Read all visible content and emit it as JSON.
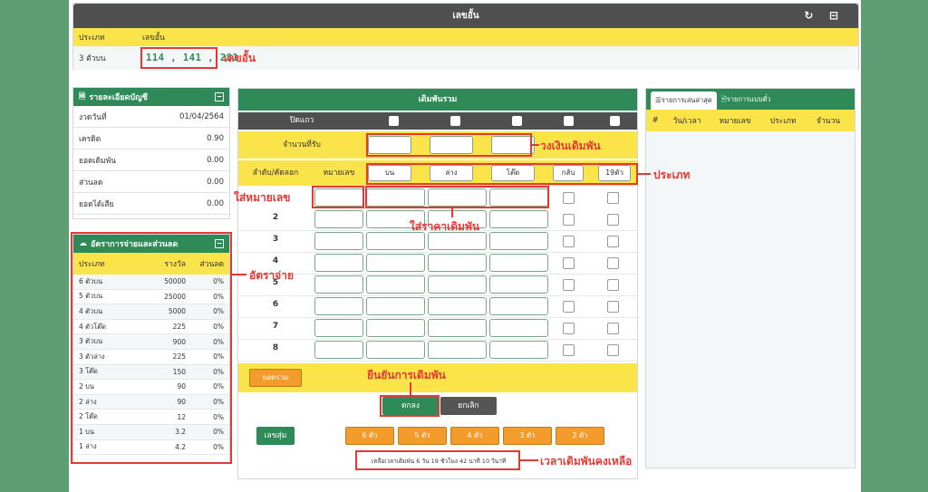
{
  "top": {
    "title": "เลขอั้น",
    "col_type": "ประเภท",
    "col_numbers": "เลขอั้น",
    "row_type": "3 ตัวบน",
    "row_numbers": "114 , 141 , 281"
  },
  "account": {
    "title": "รายละเอียดบัญชี",
    "rows": [
      {
        "label": "งวดวันที่",
        "value": "01/04/2564"
      },
      {
        "label": "เครดิต",
        "value": "0.90"
      },
      {
        "label": "ยอดเดิมพัน",
        "value": "0.00"
      },
      {
        "label": "ส่วนลด",
        "value": "0.00"
      },
      {
        "label": "ยอดได้เสีย",
        "value": "0.00"
      }
    ]
  },
  "rates": {
    "title": "อัตราการจ่ายและส่วนลด",
    "headers": [
      "ประเภท",
      "รางวัล",
      "ส่วนลด"
    ],
    "rows": [
      [
        "6 ตัวบน",
        "50000",
        "0%"
      ],
      [
        "5 ตัวบน",
        "25000",
        "0%"
      ],
      [
        "4 ตัวบน",
        "5000",
        "0%"
      ],
      [
        "4 ตัวโต๊ด",
        "225",
        "0%"
      ],
      [
        "3 ตัวบน",
        "900",
        "0%"
      ],
      [
        "3 ตัวล่าง",
        "225",
        "0%"
      ],
      [
        "3 โต๊ด",
        "150",
        "0%"
      ],
      [
        "2 บน",
        "90",
        "0%"
      ],
      [
        "2 ล่าง",
        "90",
        "0%"
      ],
      [
        "2 โต๊ด",
        "12",
        "0%"
      ],
      [
        "1 บน",
        "3.2",
        "0%"
      ],
      [
        "1 ล่าง",
        "4.2",
        "0%"
      ]
    ]
  },
  "bet": {
    "title": "เดิมพันรวม",
    "close_row": "ปิดแถว",
    "amount_label": "จำนวนที่รับ",
    "order_label": "ลำดับ/คัดลอก",
    "number_label": "หมายเลข",
    "types": [
      "บน",
      "ล่าง",
      "โต๊ด",
      "กลับ",
      "19ตัว"
    ],
    "row_numbers": [
      "2",
      "3",
      "4",
      "5",
      "6",
      "7",
      "8"
    ],
    "sum_button": "ยอดรวม",
    "ok_button": "ตกลง",
    "cancel_button": "ยกเลิก",
    "random_button": "เลขสุ่ม",
    "quick_buttons": [
      "6 ตัว",
      "5 ตัว",
      "4 ตัว",
      "3 ตัว",
      "2 ตัว"
    ],
    "time_left": "เหลือเวลาเดิมพัน 6 วัน 19 ชั่วโมง 42 นาที 10 วินาที"
  },
  "recent": {
    "tab_active": "รายการเล่นล่าสุด",
    "tab_other": "รายการแบบตั๋ว",
    "headers": [
      "#",
      "วัน/เวลา",
      "หมายเลข",
      "ประเภท",
      "จำนวน"
    ]
  },
  "annotations": {
    "locked": "เลขอั้น",
    "bet_amount": "วงเงินเดิมพัน",
    "type": "ประเภท",
    "enter_number": "ใส่หมายเลข",
    "enter_price": "ใส่ราคาเดิมพัน",
    "payout": "อัตราจ่าย",
    "confirm": "ยืนยันการเดิมพัน",
    "time_left": "เวลาเดิมพันคงเหลือ"
  }
}
